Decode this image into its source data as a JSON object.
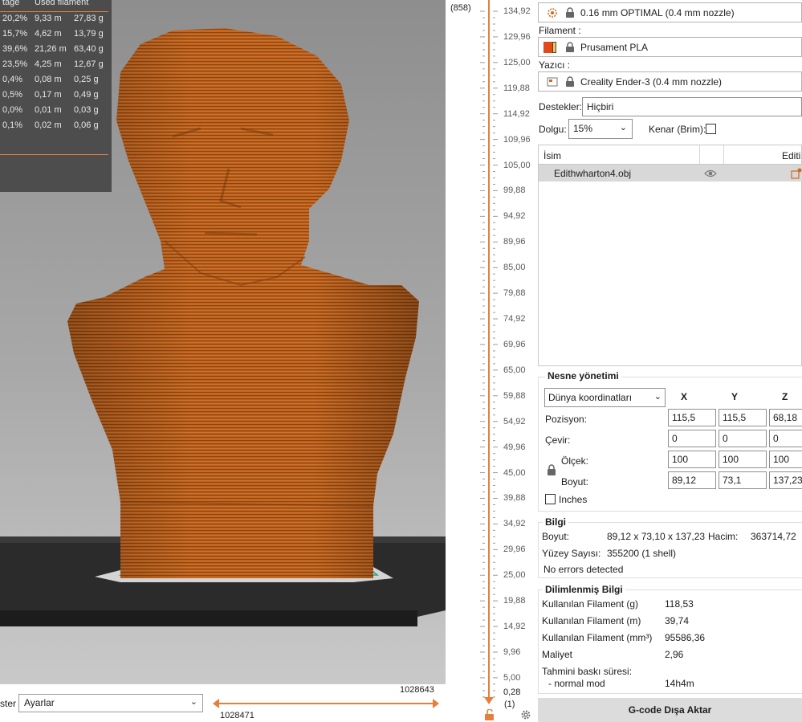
{
  "stats": {
    "headers": [
      "tage",
      "Used filament"
    ],
    "rows": [
      {
        "pct": "20,2%",
        "meters": "9,33 m",
        "grams": "27,83 g"
      },
      {
        "pct": "15,7%",
        "meters": "4,62 m",
        "grams": "13,79 g"
      },
      {
        "pct": "39,6%",
        "meters": "21,26 m",
        "grams": "63,40 g"
      },
      {
        "pct": "23,5%",
        "meters": "4,25 m",
        "grams": "12,67 g"
      },
      {
        "pct": "0,4%",
        "meters": "0,08 m",
        "grams": "0,25 g"
      },
      {
        "pct": "0,5%",
        "meters": "0,17 m",
        "grams": "0,49 g"
      },
      {
        "pct": "0,0%",
        "meters": "0,01 m",
        "grams": "0,03 g"
      },
      {
        "pct": "0,1%",
        "meters": "0,02 m",
        "grams": "0,06 g"
      }
    ]
  },
  "bottom": {
    "presets_label": "ster",
    "presets_value": "Ayarlar",
    "h_slider_left": "1028471",
    "h_slider_right": "1028643"
  },
  "vslider": {
    "top_count": "(858)",
    "bottom_count": "(1)",
    "bottom_value": "0,28",
    "ticks": [
      "134,92",
      "129,96",
      "125,00",
      "119,88",
      "114,92",
      "109,96",
      "105,00",
      "99,88",
      "94,92",
      "89,96",
      "85,00",
      "79,88",
      "74,92",
      "69,96",
      "65,00",
      "59,88",
      "54,92",
      "49,96",
      "45,00",
      "39,88",
      "34,92",
      "29,96",
      "25,00",
      "19,88",
      "14,92",
      "9,96",
      "5,00"
    ]
  },
  "sidebar": {
    "print_settings": "0.16 mm OPTIMAL (0.4 mm nozzle)",
    "filament_label": "Filament :",
    "filament_value": "Prusament PLA",
    "printer_label": "Yazıcı :",
    "printer_value": "Creality Ender-3 (0.4 mm nozzle)",
    "supports_label": "Destekler:",
    "supports_value": "Hiçbiri",
    "infill_label": "Dolgu:",
    "infill_value": "15%",
    "brim_label": "Kenar (Brim):",
    "list_col_name": "İsim",
    "list_col_edit": "Editi",
    "object_name": "Edithwharton4.obj"
  },
  "object_manip": {
    "title": "Nesne yönetimi",
    "coord_system": "Dünya koordinatları",
    "axes": [
      "X",
      "Y",
      "Z"
    ],
    "position_label": "Pozisyon:",
    "rotation_label": "Çevir:",
    "scale_label": "Ölçek:",
    "size_label": "Boyut:",
    "inches_label": "Inches",
    "position": [
      "115,5",
      "115,5",
      "68,18"
    ],
    "rotation": [
      "0",
      "0",
      "0"
    ],
    "scale": [
      "100",
      "100",
      "100"
    ],
    "size": [
      "89,12",
      "73,1",
      "137,23"
    ]
  },
  "info": {
    "title": "Bilgi",
    "size_label": "Boyut:",
    "size_value": "89,12 x 73,10 x 137,23",
    "volume_label": "Hacim:",
    "volume_value": "363714,72",
    "facets_label": "Yüzey Sayısı:",
    "facets_value": "355200 (1 shell)",
    "errors": "No errors detected"
  },
  "sliced": {
    "title": "Dilimlenmiş Bilgi",
    "rows": [
      {
        "label": "Kullanılan Filament (g)",
        "value": "118,53"
      },
      {
        "label": "Kullanılan Filament (m)",
        "value": "39,74"
      },
      {
        "label": "Kullanılan Filament (mm³)",
        "value": "95586,36"
      },
      {
        "label": "Maliyet",
        "value": "2,96"
      }
    ],
    "time_label": "Tahmini baskı süresi:",
    "mode_label": "- normal mod",
    "mode_value": "14h4m"
  },
  "export_label": "G-code Dışa Aktar",
  "colors": {
    "accent": "#e4803b",
    "model": "#c0641e",
    "bed": "#2e2e2e"
  }
}
